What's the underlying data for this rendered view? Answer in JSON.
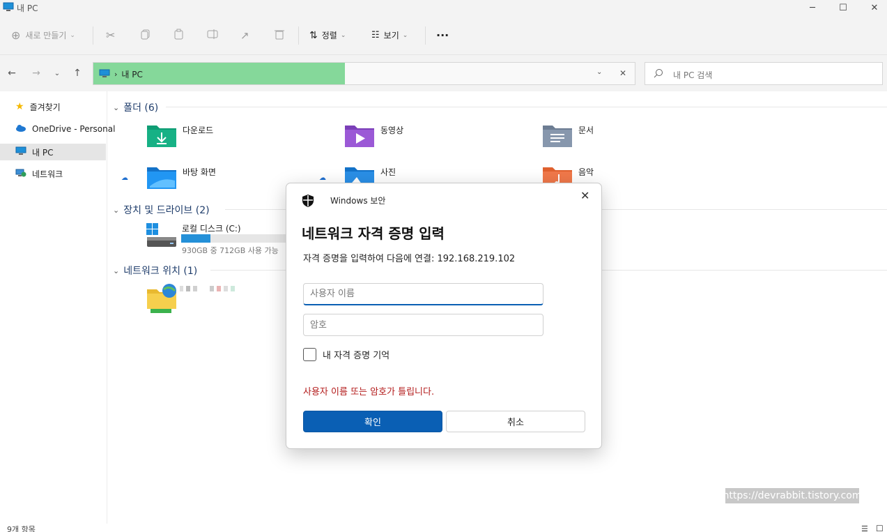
{
  "window": {
    "title": "내 PC"
  },
  "toolbar": {
    "new_label": "새로 만들기",
    "sort_label": "정렬",
    "view_label": "보기",
    "more_label": "···"
  },
  "address": {
    "path": "내 PC"
  },
  "search": {
    "placeholder": "내 PC 검색"
  },
  "sidebar": {
    "items": [
      {
        "label": "즐겨찾기"
      },
      {
        "label": "OneDrive - Personal"
      },
      {
        "label": "내 PC"
      },
      {
        "label": "네트워크"
      }
    ]
  },
  "sections": {
    "folders": {
      "label": "폴더 (6)"
    },
    "drives": {
      "label": "장치 및 드라이브 (2)"
    },
    "network": {
      "label": "네트워크 위치 (1)"
    }
  },
  "folders": [
    {
      "name": "다운로드",
      "icon": "download-folder-icon"
    },
    {
      "name": "동영상",
      "icon": "videos-folder-icon"
    },
    {
      "name": "문서",
      "icon": "documents-folder-icon"
    },
    {
      "name": "바탕 화면",
      "icon": "desktop-folder-icon"
    },
    {
      "name": "사진",
      "icon": "pictures-folder-icon"
    },
    {
      "name": "음악",
      "icon": "music-folder-icon"
    }
  ],
  "drive": {
    "name": "로컬 디스크 (C:)",
    "space": "930GB 중 712GB 사용 가능",
    "used_fraction": 0.26
  },
  "status": {
    "items": "9개 항목"
  },
  "watermark": "https://devrabbit.tistory.com",
  "dialog": {
    "caption": "Windows 보안",
    "title": "네트워크 자격 증명 입력",
    "message": "자격 증명을 입력하여 다음에 연결: 192.168.219.102",
    "username_placeholder": "사용자 이름",
    "password_placeholder": "암호",
    "remember_label": "내 자격 증명 기억",
    "error": "사용자 이름 또는 암호가 틀립니다.",
    "ok_label": "확인",
    "cancel_label": "취소"
  },
  "colors": {
    "accent": "#0a5fb4",
    "error": "#b31a1a",
    "address_highlight": "#85d89a"
  }
}
